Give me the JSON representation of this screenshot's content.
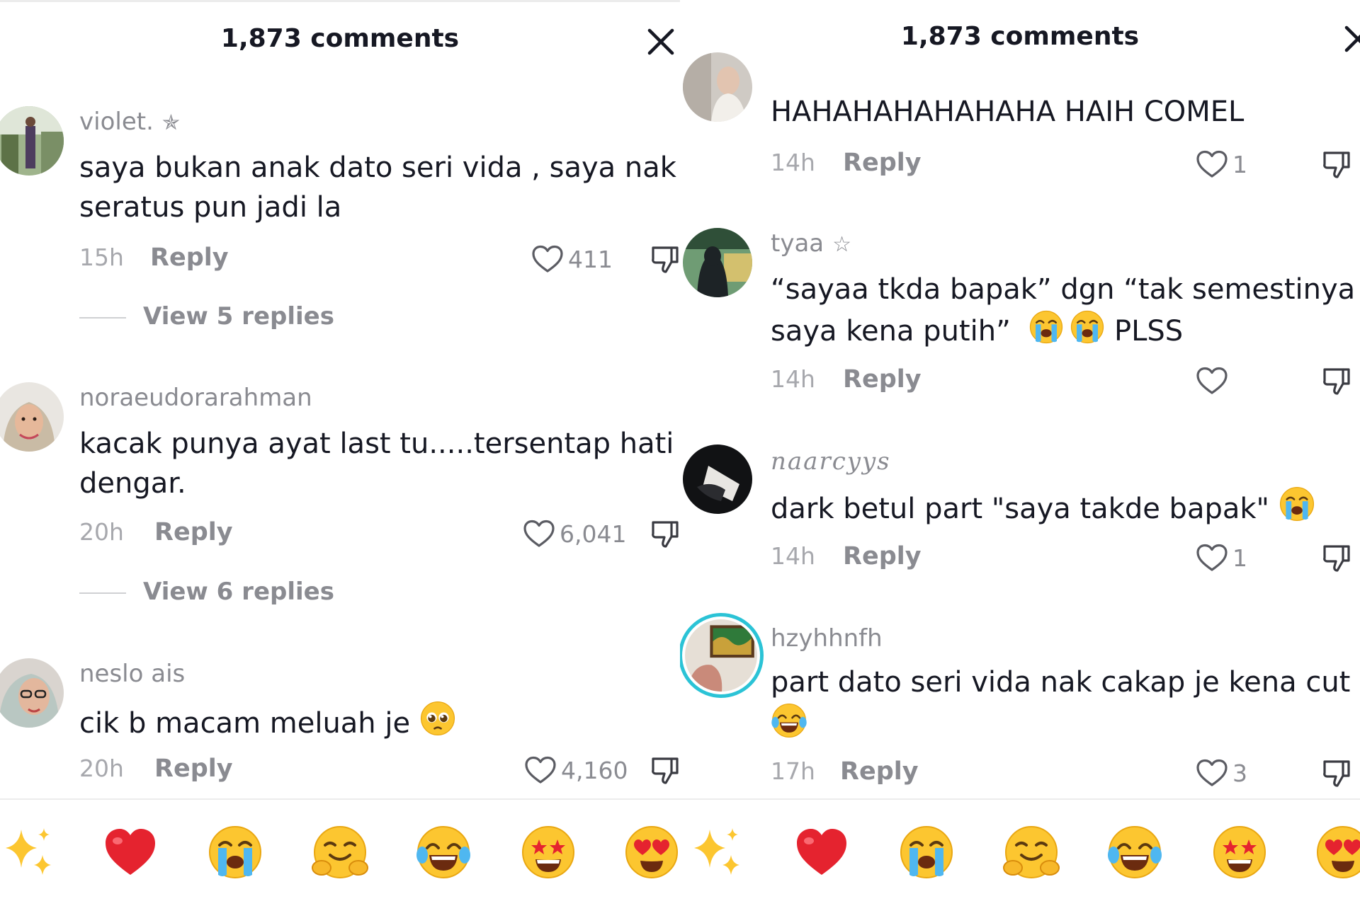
{
  "left": {
    "title": "1,873 comments",
    "comments": [
      {
        "username": "violet.",
        "user_mark": "✯",
        "text": "saya bukan anak dato seri vida , saya nak\nseratus pun jadi la",
        "time": "15h",
        "reply": "Reply",
        "likes": "411",
        "view_replies": "View 5 replies"
      },
      {
        "username": "noraeudorarahman",
        "text": "kacak punya ayat last tu.....tersentap hati\ndengar.",
        "time": "20h",
        "reply": "Reply",
        "likes": "6,041",
        "view_replies": "View 6 replies"
      },
      {
        "username": "neslo ais",
        "text": "cik b macam meluah je",
        "emoji": "pleading-face",
        "time": "20h",
        "reply": "Reply",
        "likes": "4,160"
      }
    ]
  },
  "right": {
    "title": "1,873 comments",
    "comments": [
      {
        "text": "HAHAHAHAHAHAHA HAIH COMEL",
        "time": "14h",
        "reply": "Reply",
        "likes": "1"
      },
      {
        "username": "tyaa",
        "user_mark": "☆",
        "text": "“sayaa tkda bapak” dgn “tak semestinya\nsaya kena putih”",
        "text_suffix": "PLSS",
        "emoji": "loudly-crying-face",
        "time": "14h",
        "reply": "Reply",
        "likes": ""
      },
      {
        "username": "naarcyys",
        "text": "dark betul part \"saya takde bapak\"",
        "emoji": "loudly-crying-face",
        "time": "14h",
        "reply": "Reply",
        "likes": "1"
      },
      {
        "username": "hzyhhnfh",
        "text": "part dato seri vida nak cakap je kena cut",
        "emoji": "face-with-tears-of-joy",
        "time": "17h",
        "reply": "Reply",
        "likes": "3"
      }
    ]
  },
  "emoji_bar": [
    "sparkles",
    "red-heart",
    "loudly-crying-face",
    "hugging-face",
    "face-with-tears-of-joy",
    "star-struck",
    "smiling-face-with-heart-eyes"
  ],
  "colors": {
    "text": "#161823",
    "muted": "#8a8b91",
    "time": "#a7a8ad",
    "avatar_ring": "#2bc3d6",
    "heart_red": "#e5232f",
    "emoji_yellow": "#fcc630"
  }
}
